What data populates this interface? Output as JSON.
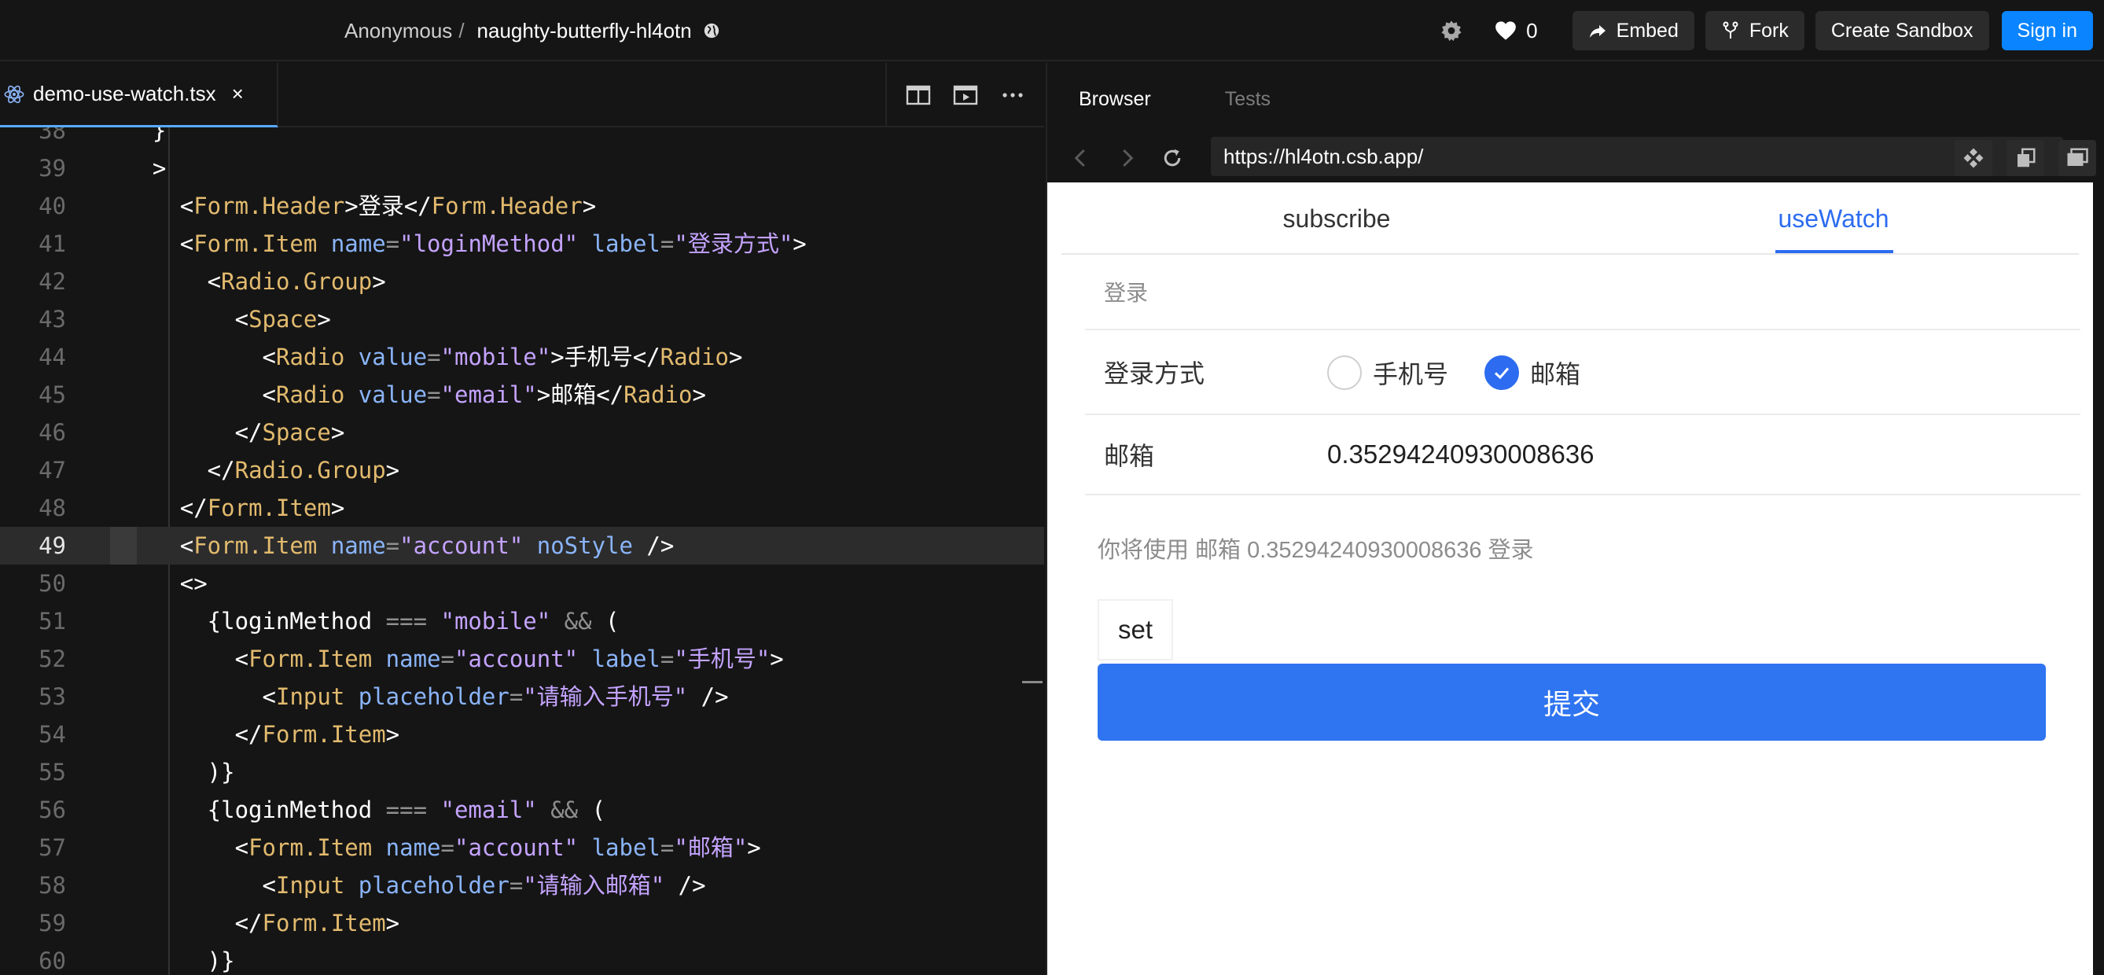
{
  "topbar": {
    "owner": "Anonymous",
    "separator": "/",
    "sandbox_name": "naughty-butterfly-hl4otn",
    "likes": "0",
    "embed_label": "Embed",
    "fork_label": "Fork",
    "create_label": "Create Sandbox",
    "signin_label": "Sign in",
    "icons": [
      "globe-icon",
      "gear-icon",
      "heart-icon",
      "share-arrow-icon",
      "fork-icon"
    ],
    "accent": "#0a84ff"
  },
  "editor": {
    "file_tab": "demo-use-watch.tsx",
    "close_glyph": "×",
    "active_line": 49,
    "lines": [
      {
        "n": "38",
        "t": [
          [
            "    }",
            "txt"
          ]
        ]
      },
      {
        "n": "39",
        "t": [
          [
            "    >",
            "txt"
          ]
        ]
      },
      {
        "n": "40",
        "t": [
          [
            "      <",
            "txt"
          ],
          [
            "Form.Header",
            "tag"
          ],
          [
            ">登录</",
            "txt"
          ],
          [
            "Form.Header",
            "tag"
          ],
          [
            ">",
            "txt"
          ]
        ]
      },
      {
        "n": "41",
        "t": [
          [
            "      <",
            "txt"
          ],
          [
            "Form.Item",
            "tag"
          ],
          [
            " ",
            "txt"
          ],
          [
            "name",
            "attr"
          ],
          [
            "=",
            "op"
          ],
          [
            "\"loginMethod\"",
            "str"
          ],
          [
            " ",
            "txt"
          ],
          [
            "label",
            "attr"
          ],
          [
            "=",
            "op"
          ],
          [
            "\"登录方式\"",
            "str"
          ],
          [
            ">",
            "txt"
          ]
        ]
      },
      {
        "n": "42",
        "t": [
          [
            "        <",
            "txt"
          ],
          [
            "Radio.Group",
            "tag"
          ],
          [
            ">",
            "txt"
          ]
        ]
      },
      {
        "n": "43",
        "t": [
          [
            "          <",
            "txt"
          ],
          [
            "Space",
            "tag"
          ],
          [
            ">",
            "txt"
          ]
        ]
      },
      {
        "n": "44",
        "t": [
          [
            "            <",
            "txt"
          ],
          [
            "Radio",
            "tag"
          ],
          [
            " ",
            "txt"
          ],
          [
            "value",
            "attr"
          ],
          [
            "=",
            "op"
          ],
          [
            "\"mobile\"",
            "str"
          ],
          [
            ">手机号</",
            "txt"
          ],
          [
            "Radio",
            "tag"
          ],
          [
            ">",
            "txt"
          ]
        ]
      },
      {
        "n": "45",
        "t": [
          [
            "            <",
            "txt"
          ],
          [
            "Radio",
            "tag"
          ],
          [
            " ",
            "txt"
          ],
          [
            "value",
            "attr"
          ],
          [
            "=",
            "op"
          ],
          [
            "\"email\"",
            "str"
          ],
          [
            ">邮箱</",
            "txt"
          ],
          [
            "Radio",
            "tag"
          ],
          [
            ">",
            "txt"
          ]
        ]
      },
      {
        "n": "46",
        "t": [
          [
            "          </",
            "txt"
          ],
          [
            "Space",
            "tag"
          ],
          [
            ">",
            "txt"
          ]
        ]
      },
      {
        "n": "47",
        "t": [
          [
            "        </",
            "txt"
          ],
          [
            "Radio.Group",
            "tag"
          ],
          [
            ">",
            "txt"
          ]
        ]
      },
      {
        "n": "48",
        "t": [
          [
            "      </",
            "txt"
          ],
          [
            "Form.Item",
            "tag"
          ],
          [
            ">",
            "txt"
          ]
        ]
      },
      {
        "n": "49",
        "t": [
          [
            "      <",
            "txt"
          ],
          [
            "Form.Item",
            "tag"
          ],
          [
            " ",
            "txt"
          ],
          [
            "name",
            "attr"
          ],
          [
            "=",
            "op"
          ],
          [
            "\"account\"",
            "str"
          ],
          [
            " ",
            "txt"
          ],
          [
            "noStyle",
            "attr"
          ],
          [
            " />",
            "txt"
          ]
        ]
      },
      {
        "n": "50",
        "t": [
          [
            "      <>",
            "txt"
          ]
        ]
      },
      {
        "n": "51",
        "t": [
          [
            "        {loginMethod ",
            "txt"
          ],
          [
            "===",
            "op"
          ],
          [
            " ",
            "txt"
          ],
          [
            "\"mobile\"",
            "str"
          ],
          [
            " ",
            "txt"
          ],
          [
            "&&",
            "op"
          ],
          [
            " (",
            "txt"
          ]
        ]
      },
      {
        "n": "52",
        "t": [
          [
            "          <",
            "txt"
          ],
          [
            "Form.Item",
            "tag"
          ],
          [
            " ",
            "txt"
          ],
          [
            "name",
            "attr"
          ],
          [
            "=",
            "op"
          ],
          [
            "\"account\"",
            "str"
          ],
          [
            " ",
            "txt"
          ],
          [
            "label",
            "attr"
          ],
          [
            "=",
            "op"
          ],
          [
            "\"手机号\"",
            "str"
          ],
          [
            ">",
            "txt"
          ]
        ]
      },
      {
        "n": "53",
        "t": [
          [
            "            <",
            "txt"
          ],
          [
            "Input",
            "tag"
          ],
          [
            " ",
            "txt"
          ],
          [
            "placeholder",
            "attr"
          ],
          [
            "=",
            "op"
          ],
          [
            "\"请输入手机号\"",
            "str"
          ],
          [
            " />",
            "txt"
          ]
        ]
      },
      {
        "n": "54",
        "t": [
          [
            "          </",
            "txt"
          ],
          [
            "Form.Item",
            "tag"
          ],
          [
            ">",
            "txt"
          ]
        ]
      },
      {
        "n": "55",
        "t": [
          [
            "        )}",
            "txt"
          ]
        ]
      },
      {
        "n": "56",
        "t": [
          [
            "        {loginMethod ",
            "txt"
          ],
          [
            "===",
            "op"
          ],
          [
            " ",
            "txt"
          ],
          [
            "\"email\"",
            "str"
          ],
          [
            " ",
            "txt"
          ],
          [
            "&&",
            "op"
          ],
          [
            " (",
            "txt"
          ]
        ]
      },
      {
        "n": "57",
        "t": [
          [
            "          <",
            "txt"
          ],
          [
            "Form.Item",
            "tag"
          ],
          [
            " ",
            "txt"
          ],
          [
            "name",
            "attr"
          ],
          [
            "=",
            "op"
          ],
          [
            "\"account\"",
            "str"
          ],
          [
            " ",
            "txt"
          ],
          [
            "label",
            "attr"
          ],
          [
            "=",
            "op"
          ],
          [
            "\"邮箱\"",
            "str"
          ],
          [
            ">",
            "txt"
          ]
        ]
      },
      {
        "n": "58",
        "t": [
          [
            "            <",
            "txt"
          ],
          [
            "Input",
            "tag"
          ],
          [
            " ",
            "txt"
          ],
          [
            "placeholder",
            "attr"
          ],
          [
            "=",
            "op"
          ],
          [
            "\"请输入邮箱\"",
            "str"
          ],
          [
            " />",
            "txt"
          ]
        ]
      },
      {
        "n": "59",
        "t": [
          [
            "          </",
            "txt"
          ],
          [
            "Form.Item",
            "tag"
          ],
          [
            ">",
            "txt"
          ]
        ]
      },
      {
        "n": "60",
        "t": [
          [
            "        )}",
            "txt"
          ]
        ]
      }
    ],
    "syntax_colors": {
      "tag": "#e2ba6e",
      "attr": "#8ab4f8",
      "str": "#c4a3ff",
      "op": "#8f8f8f",
      "txt": "#e6e6e6"
    }
  },
  "browser": {
    "tab_browser": "Browser",
    "tab_tests": "Tests",
    "url": "https://hl4otn.csb.app/",
    "page": {
      "tab_subscribe": "subscribe",
      "tab_usewatch": "useWatch",
      "form_header": "登录",
      "login_method_label": "登录方式",
      "radio_mobile": "手机号",
      "radio_email": "邮箱",
      "selected_radio": "邮箱",
      "account_label": "邮箱",
      "account_value": "0.35294240930008636",
      "hint": "你将使用 邮箱 0.35294240930008636 登录",
      "set_label": "set",
      "submit_label": "提交",
      "accent": "#2d6cf0"
    }
  }
}
